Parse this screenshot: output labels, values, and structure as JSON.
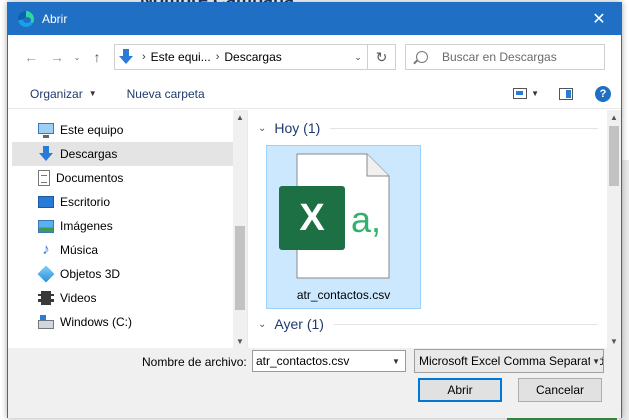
{
  "background": {
    "title": "Nombre Campaña:"
  },
  "dialog": {
    "title": "Abrir",
    "nav": {
      "breadcrumb": [
        "Este equi...",
        "Descargas"
      ],
      "search_placeholder": "Buscar en Descargas"
    },
    "toolbar": {
      "organize": "Organizar",
      "new_folder": "Nueva carpeta",
      "help": "?"
    },
    "tree": [
      {
        "label": "Este equipo",
        "icon": "computer-icon",
        "selected": false
      },
      {
        "label": "Descargas",
        "icon": "downloads-icon",
        "selected": true
      },
      {
        "label": "Documentos",
        "icon": "documents-icon",
        "selected": false
      },
      {
        "label": "Escritorio",
        "icon": "desktop-icon",
        "selected": false
      },
      {
        "label": "Imágenes",
        "icon": "pictures-icon",
        "selected": false
      },
      {
        "label": "Música",
        "icon": "music-icon",
        "selected": false
      },
      {
        "label": "Objetos 3D",
        "icon": "3d-objects-icon",
        "selected": false
      },
      {
        "label": "Videos",
        "icon": "videos-icon",
        "selected": false
      },
      {
        "label": "Windows (C:)",
        "icon": "drive-icon",
        "selected": false
      }
    ],
    "groups": [
      {
        "label": "Hoy (1)"
      },
      {
        "label": "Ayer (1)"
      }
    ],
    "file": {
      "name": "atr_contactos.csv",
      "icon": "excel-csv-icon",
      "badge_letter": "X",
      "glyph": "a,"
    },
    "filename_label": "Nombre de archivo:",
    "filename_value": "atr_contactos.csv",
    "file_type": "Microsoft Excel Comma Separated",
    "open_button": "Abrir",
    "cancel_button": "Cancelar"
  },
  "colors": {
    "accent": "#1f6fc4",
    "excel_green": "#1d7044",
    "selection": "#cce8ff"
  }
}
